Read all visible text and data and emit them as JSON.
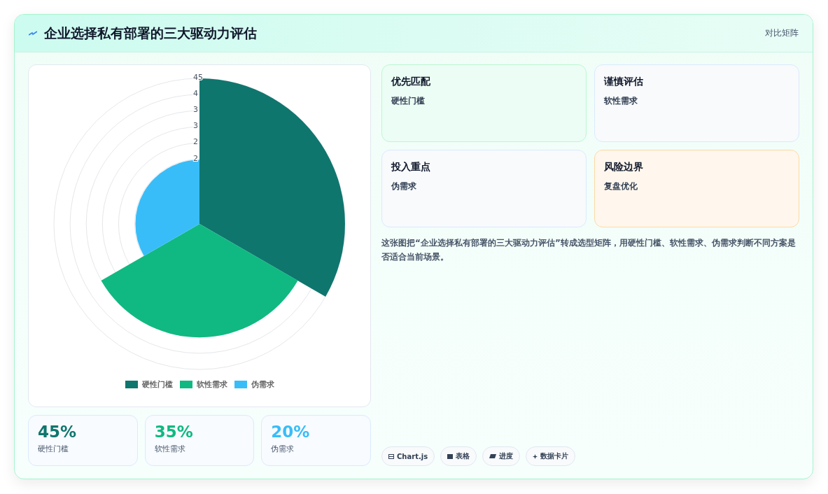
{
  "header": {
    "title": "企业选择私有部署的三大驱动力评估",
    "action": "对比矩阵"
  },
  "chart": {
    "tick_labels": [
      "45",
      "4",
      "3",
      "3",
      "2",
      "2"
    ],
    "legend": [
      {
        "label": "硬性门槛",
        "color": "#0f766e"
      },
      {
        "label": "软性需求",
        "color": "#10b981"
      },
      {
        "label": "伪需求",
        "color": "#38bdf8"
      }
    ]
  },
  "stats": [
    {
      "value": "45%",
      "label": "硬性门槛",
      "color": "#0f766e"
    },
    {
      "value": "35%",
      "label": "软性需求",
      "color": "#10b981"
    },
    {
      "value": "20%",
      "label": "伪需求",
      "color": "#38bdf8"
    }
  ],
  "matrix": [
    {
      "title": "优先匹配",
      "text": "硬性门槛",
      "kind": "green"
    },
    {
      "title": "谨慎评估",
      "text": "软性需求",
      "kind": "plain"
    },
    {
      "title": "投入重点",
      "text": "伪需求",
      "kind": "plain"
    },
    {
      "title": "风险边界",
      "text": "复盘优化",
      "kind": "amber"
    }
  ],
  "description": "这张图把“企业选择私有部署的三大驱动力评估”转成选型矩阵，用硬性门槛、软性需求、伪需求判断不同方案是否适合当前场景。",
  "tags": [
    {
      "label": "Chart.js",
      "kind": "chart"
    },
    {
      "label": "表格",
      "kind": "table"
    },
    {
      "label": "进度",
      "kind": "progress"
    },
    {
      "label": "数据卡片",
      "kind": "card"
    }
  ]
}
